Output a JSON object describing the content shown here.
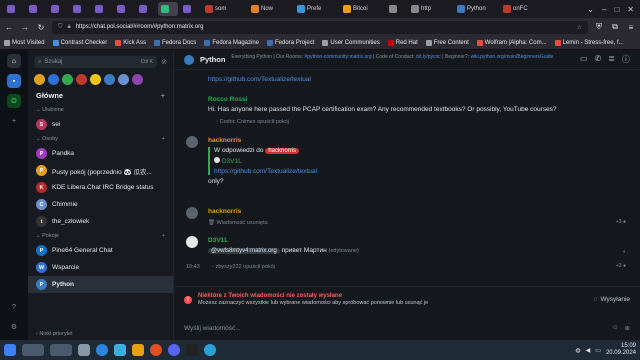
{
  "browser": {
    "tabs": [
      {
        "label": "",
        "color": "#7a5cc9"
      },
      {
        "label": "",
        "color": "#7a5cc9"
      },
      {
        "label": "",
        "color": "#7a5cc9"
      },
      {
        "label": "",
        "color": "#7a5cc9"
      },
      {
        "label": "",
        "color": "#7a5cc9"
      },
      {
        "label": "",
        "color": "#7a5cc9"
      },
      {
        "label": "",
        "color": "#7a5cc9"
      },
      {
        "label": "",
        "color": "#2bc07e",
        "active": true
      },
      {
        "label": "",
        "color": "#7a5cc9"
      },
      {
        "label": "som",
        "color": "#c0392b"
      },
      {
        "label": "Now",
        "color": "#e67e22"
      },
      {
        "label": "Prefe",
        "color": "#3498db"
      },
      {
        "label": "Bitcoi",
        "color": "#f39c12"
      },
      {
        "label": "",
        "color": "#888"
      },
      {
        "label": "http",
        "color": "#888"
      },
      {
        "label": "Python",
        "color": "#3b7bbf"
      },
      {
        "label": "onFC",
        "color": "#c0392b"
      }
    ],
    "url": "https://chat.pol.social/#/room/#python:matrix.org",
    "bookmarks": [
      {
        "label": "Most Visited",
        "color": "#9aa0a6"
      },
      {
        "label": "Contrast Checker",
        "color": "#4a90e2"
      },
      {
        "label": "Kick Ass",
        "color": "#e74c3c"
      },
      {
        "label": "Fedora Docs",
        "color": "#3c6eb4"
      },
      {
        "label": "Fedora Magazine",
        "color": "#3c6eb4"
      },
      {
        "label": "Fedora Project",
        "color": "#3c6eb4"
      },
      {
        "label": "User Communities",
        "color": "#9aa0a6"
      },
      {
        "label": "Red Hat",
        "color": "#cc0000"
      },
      {
        "label": "Free Content",
        "color": "#9aa0a6"
      },
      {
        "label": "Wolfram |Alpha: Com...",
        "color": "#e74c3c"
      },
      {
        "label": "Lemin - Stress-free, f...",
        "color": "#e74c3c"
      }
    ]
  },
  "sidebar": {
    "search_placeholder": "Szukaj",
    "search_shortcut": "Ctrl K",
    "space_title": "Główne",
    "sections": {
      "favourites": "Ulubione",
      "people": "Osoby",
      "rooms": "Pokoje",
      "low_priority": "Niski priorytet"
    },
    "favourites": [
      {
        "name": "sei",
        "initial": "S",
        "color": "#b33a5b"
      }
    ],
    "people": [
      {
        "name": "Pandka",
        "initial": "P",
        "color": "#a03ac0"
      },
      {
        "name": "Pusty pokój (poprzednio 🐼 瓜农...",
        "initial": "P",
        "color": "#e0a020"
      },
      {
        "name": "KDE Libera.Chat IRC Bridge status",
        "initial": "K",
        "color": "#b52a2a"
      },
      {
        "name": "Chimmie",
        "initial": "C",
        "color": "#6c8fd0"
      },
      {
        "name": "the_człowiek",
        "initial": "t",
        "color": "#333"
      }
    ],
    "rooms": [
      {
        "name": "Pine64 General Chat",
        "initial": "P",
        "color": "#0d72c7"
      },
      {
        "name": "Wsparcie",
        "initial": "W",
        "color": "#2f70d0"
      },
      {
        "name": "Python",
        "initial": "P",
        "color": "#3b7bbf",
        "active": true
      }
    ]
  },
  "room": {
    "name": "Python",
    "topic_parts": [
      "Everything Python | Our Rooms: ",
      "#python-community:matrix.org",
      " | Code of Conduct: ",
      "bit.ly/pycoc",
      " | Beginner?: ",
      "wiki.python.org/moin/BeginnersGuide"
    ]
  },
  "timeline": {
    "top_link": "https://github.com/Textualize/textual",
    "msg1": {
      "sender": "Rocco Rossi",
      "sender_color": "#33a852",
      "text": "Hi. Has anyone here passed the PCAP certification exam? Any recommended textbooks? Or possibly, YouTube courses?",
      "notice": "Cedric Coimes opuścił pokój"
    },
    "msg2": {
      "sender": "hacknorris",
      "sender_color": "#e69a20",
      "reply_prefix": "W odpowiedzi do",
      "reply_to": "hacknorris",
      "quoted_sender": "D3V1L",
      "quoted_link": "https://github.com/Textualize/textual",
      "text": "only?"
    },
    "msg3": {
      "sender": "hacknorris",
      "sender_color": "#e69a20",
      "notice": "Wiadomość usunięta"
    },
    "msg4": {
      "sender": "D3V1L",
      "sender_color": "#33a852",
      "mention": "@vwfs8mtyv4:matrix.org",
      "text": "привет Мартин",
      "edited": "(edytowane)",
      "time": "10:43",
      "notice": "zbyszy222 opuścił pokój"
    }
  },
  "error_banner": {
    "title": "Niektóre z Twoich wiadomości nie zostały wysłane",
    "desc": "Możesz zaznaczyć wszystkie lub wybrane wiadomości aby spróbować ponownie lub usunąć je",
    "status": "Wysyłanie"
  },
  "composer": {
    "placeholder": "Wyślij wiadomość..."
  },
  "taskbar": {
    "time": "15:09",
    "date": "20.09.2024"
  }
}
